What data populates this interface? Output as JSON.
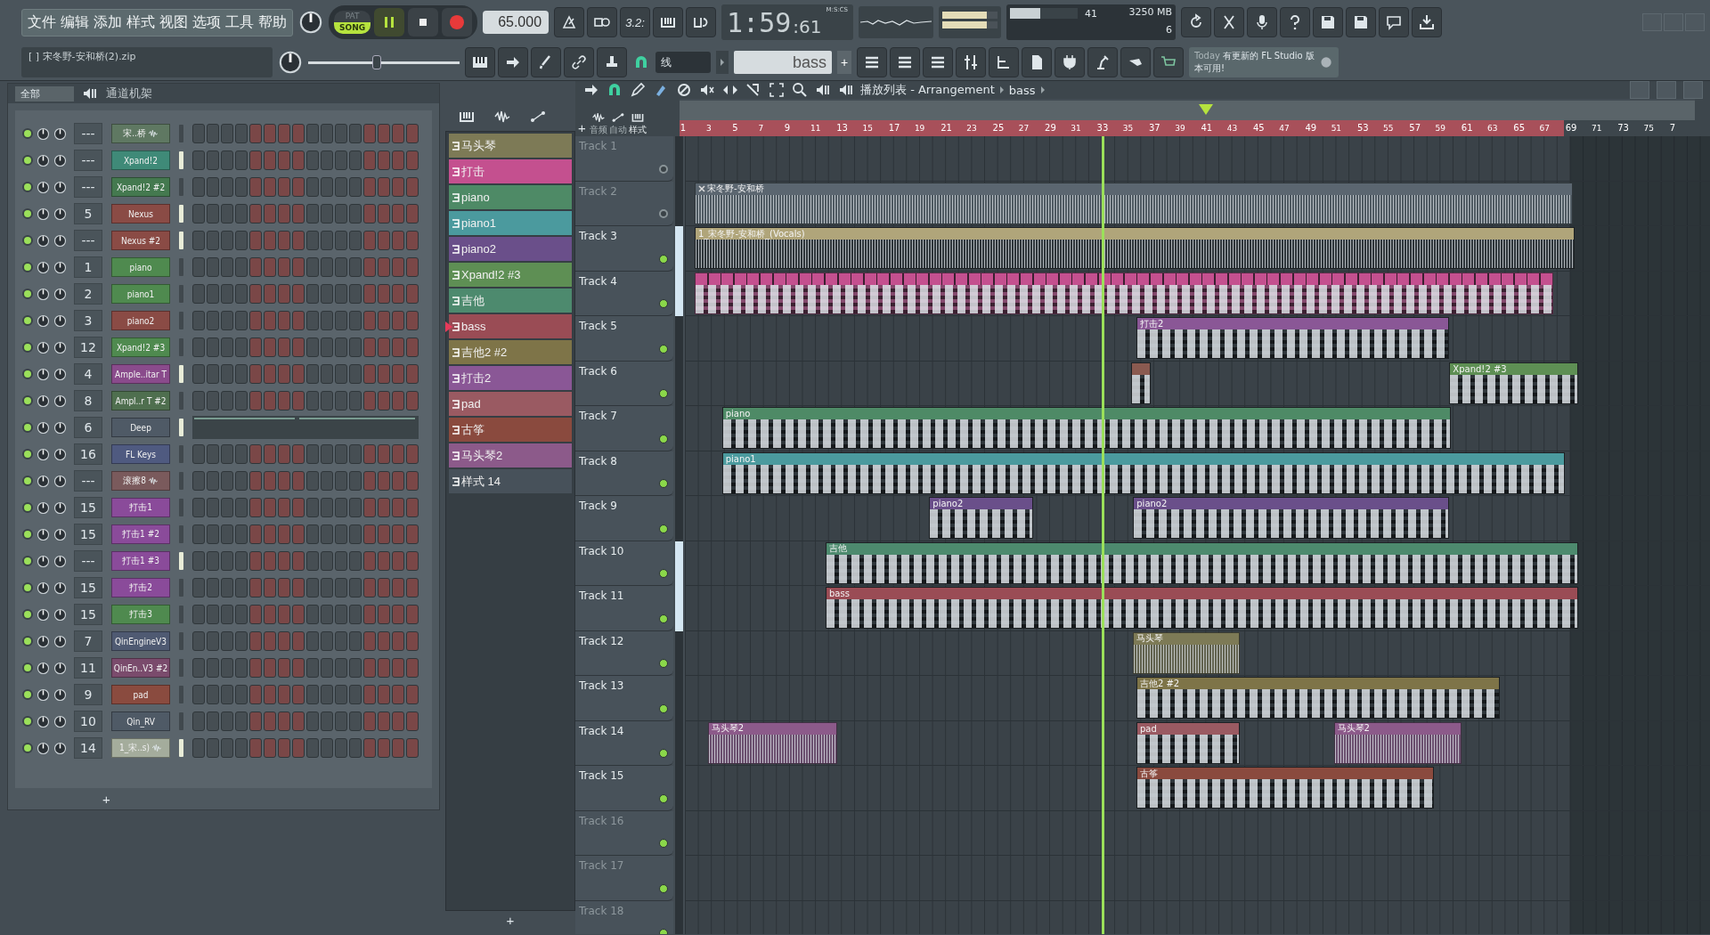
{
  "menu": [
    "文件",
    "编辑",
    "添加",
    "样式",
    "视图",
    "选项",
    "工具",
    "帮助"
  ],
  "transport": {
    "modes": [
      {
        "label": "PAT",
        "selected": false
      },
      {
        "label": "SONG",
        "selected": true
      }
    ],
    "playing": true,
    "tempo": "65.000",
    "countdown": "3.2:",
    "time": "1:59",
    "time_cs": ":61",
    "time_format": "M:S:CS"
  },
  "monitor": {
    "cpu": "41",
    "memory": "3250 MB",
    "polyphony": "6",
    "level": 0.45
  },
  "project_file": "[   ] 宋冬野-安和桥(2).zip",
  "master_slider": {
    "level": 0.45
  },
  "snap": "线",
  "current_pattern": "bass",
  "add_pattern": "+",
  "hint": {
    "day": "Today",
    "message": "有更新的 FL Studio 版本可用!"
  },
  "channel_rack": {
    "filter": "全部",
    "title": "通道机架",
    "add": "+",
    "channels": [
      {
        "number": "---",
        "name": "宋..桥",
        "kind": "sample",
        "color": "#5f7862",
        "selected": false
      },
      {
        "number": "---",
        "name": "Xpand!2",
        "kind": "instrument",
        "color": "#3f8a78",
        "selected": true
      },
      {
        "number": "---",
        "name": "Xpand!2 #2",
        "kind": "instrument",
        "color": "#44794f",
        "selected": false
      },
      {
        "number": "5",
        "name": "Nexus",
        "kind": "instrument",
        "color": "#8a4b45",
        "selected": true
      },
      {
        "number": "---",
        "name": "Nexus #2",
        "kind": "instrument",
        "color": "#8a4b45",
        "selected": true
      },
      {
        "number": "1",
        "name": "piano",
        "kind": "instrument",
        "color": "#4f8a4f",
        "selected": false
      },
      {
        "number": "2",
        "name": "piano1",
        "kind": "instrument",
        "color": "#4f8a4f",
        "selected": false
      },
      {
        "number": "3",
        "name": "piano2",
        "kind": "instrument",
        "color": "#8a4b45",
        "selected": false
      },
      {
        "number": "12",
        "name": "Xpand!2 #3",
        "kind": "instrument",
        "color": "#4f8a4f",
        "selected": false
      },
      {
        "number": "4",
        "name": "Ample..itar T",
        "kind": "instrument",
        "color": "#8a4b8c",
        "selected": true
      },
      {
        "number": "8",
        "name": "Ampl..r T #2",
        "kind": "instrument",
        "color": "#4f6f4f",
        "selected": false
      },
      {
        "number": "6",
        "name": "Deep",
        "kind": "automation",
        "color": "#4f5a66",
        "selected": true
      },
      {
        "number": "16",
        "name": "FL Keys",
        "kind": "instrument",
        "color": "#4f5a80",
        "selected": false
      },
      {
        "number": "---",
        "name": "滚擦8",
        "kind": "sample",
        "color": "#7a5a5c",
        "selected": false
      },
      {
        "number": "15",
        "name": "打击1",
        "kind": "instrument",
        "color": "#8a4b9a",
        "selected": false
      },
      {
        "number": "15",
        "name": "打击1 #2",
        "kind": "instrument",
        "color": "#8a4b9a",
        "selected": false
      },
      {
        "number": "---",
        "name": "打击1 #3",
        "kind": "instrument",
        "color": "#8a4b9a",
        "selected": true
      },
      {
        "number": "15",
        "name": "打击2",
        "kind": "instrument",
        "color": "#8a4b9a",
        "selected": false
      },
      {
        "number": "15",
        "name": "打击3",
        "kind": "instrument",
        "color": "#4f8a4f",
        "selected": false
      },
      {
        "number": "7",
        "name": "QinEngineV3",
        "kind": "instrument",
        "color": "#4f5a72",
        "selected": false
      },
      {
        "number": "11",
        "name": "QinEn..V3 #2",
        "kind": "instrument",
        "color": "#7a4b6c",
        "selected": false
      },
      {
        "number": "9",
        "name": "pad",
        "kind": "instrument",
        "color": "#8a4b3f",
        "selected": false
      },
      {
        "number": "10",
        "name": "Qin_RV",
        "kind": "instrument",
        "color": "#4f5a66",
        "selected": false
      },
      {
        "number": "14",
        "name": "1_宋..s)",
        "kind": "sample",
        "color": "#a4ac9c",
        "selected": true
      }
    ]
  },
  "pattern_list": {
    "add": "+",
    "patterns": [
      {
        "name": "马头琴",
        "color": "#7d7a56",
        "selected": false
      },
      {
        "name": "打击",
        "color": "#c4508f",
        "selected": false
      },
      {
        "name": "piano",
        "color": "#4e8a66",
        "selected": false
      },
      {
        "name": "piano1",
        "color": "#4b9a9e",
        "selected": false
      },
      {
        "name": "piano2",
        "color": "#6a4f8a",
        "selected": false
      },
      {
        "name": "Xpand!2 #3",
        "color": "#5e8f54",
        "selected": false
      },
      {
        "name": "吉他",
        "color": "#4d8a6e",
        "selected": false
      },
      {
        "name": "bass",
        "color": "#9a4c55",
        "selected": true
      },
      {
        "name": "吉他2 #2",
        "color": "#7e7448",
        "selected": false
      },
      {
        "name": "打击2",
        "color": "#8a5796",
        "selected": false
      },
      {
        "name": "pad",
        "color": "#9a5a62",
        "selected": false
      },
      {
        "name": "古筝",
        "color": "#8a4a3e",
        "selected": false
      },
      {
        "name": "马头琴2",
        "color": "#8c5a8a",
        "selected": false
      },
      {
        "name": "样式 14",
        "color": "#47515a",
        "selected": false
      }
    ]
  },
  "playlist": {
    "title": "播放列表 - Arrangement",
    "pattern": "bass",
    "add_track": "+",
    "columns": [
      "音频",
      "自动",
      "样式"
    ],
    "ruler": [
      "1",
      "3",
      "5",
      "7",
      "9",
      "11",
      "13",
      "15",
      "17",
      "19",
      "21",
      "23",
      "25",
      "27",
      "29",
      "31",
      "33",
      "35",
      "37",
      "39",
      "41",
      "43",
      "45",
      "47",
      "49",
      "51",
      "53",
      "55",
      "57",
      "59",
      "61",
      "63",
      "65",
      "67",
      "69",
      "71",
      "73",
      "75",
      "7"
    ],
    "tracks": [
      {
        "name": "Track 1",
        "dimmed": true,
        "active": false,
        "marked": false
      },
      {
        "name": "Track 2",
        "dimmed": true,
        "active": false,
        "marked": false,
        "clips": [
          {
            "kind": "audio",
            "name": "宋冬野-安和桥",
            "color": "#5b6670",
            "muted": true
          }
        ]
      },
      {
        "name": "Track 3",
        "dimmed": false,
        "active": true,
        "marked": true,
        "clips": [
          {
            "kind": "vocal",
            "name": "1_宋冬野-安和桥_(Vocals)",
            "color": "#b0a57a",
            "muted": false
          }
        ]
      },
      {
        "name": "Track 4",
        "dimmed": false,
        "active": true,
        "marked": true,
        "clips": [
          {
            "kind": "strip",
            "color": "#c4508f",
            "muted": false
          }
        ]
      },
      {
        "name": "Track 5",
        "dimmed": false,
        "active": true,
        "marked": false,
        "clips": [
          {
            "kind": "pattern",
            "name": "打击2",
            "color": "#8a5796",
            "muted": false
          }
        ]
      },
      {
        "name": "Track 6",
        "dimmed": false,
        "active": true,
        "marked": false,
        "clips": [
          {
            "kind": "pattern",
            "color": "#8a5a50",
            "muted": false
          },
          {
            "kind": "pattern",
            "name": "Xpand!2 #3",
            "color": "#5e8f54",
            "muted": false
          }
        ]
      },
      {
        "name": "Track 7",
        "dimmed": false,
        "active": true,
        "marked": false,
        "clips": [
          {
            "kind": "pattern",
            "name": "piano",
            "color": "#4e8a66",
            "muted": false
          }
        ]
      },
      {
        "name": "Track 8",
        "dimmed": false,
        "active": true,
        "marked": false,
        "clips": [
          {
            "kind": "pattern",
            "name": "piano1",
            "color": "#4b9a9e",
            "muted": false
          }
        ]
      },
      {
        "name": "Track 9",
        "dimmed": false,
        "active": true,
        "marked": false,
        "clips": [
          {
            "kind": "pattern",
            "name": "piano2",
            "color": "#6a4f8a",
            "muted": false
          },
          {
            "kind": "pattern",
            "name": "piano2",
            "color": "#6a4f8a",
            "muted": false
          }
        ]
      },
      {
        "name": "Track 10",
        "dimmed": false,
        "active": true,
        "marked": true,
        "clips": [
          {
            "kind": "pattern",
            "name": "吉他",
            "color": "#4d8a6e",
            "muted": false
          }
        ]
      },
      {
        "name": "Track 11",
        "dimmed": false,
        "active": true,
        "marked": true,
        "clips": [
          {
            "kind": "pattern",
            "name": "bass",
            "color": "#9a4c55",
            "muted": false
          }
        ]
      },
      {
        "name": "Track 12",
        "dimmed": false,
        "active": true,
        "marked": false,
        "clips": [
          {
            "kind": "audio",
            "name": "马头琴",
            "color": "#7d7a56",
            "muted": false
          }
        ]
      },
      {
        "name": "Track 13",
        "dimmed": false,
        "active": true,
        "marked": false,
        "clips": [
          {
            "kind": "pattern",
            "name": "吉他2 #2",
            "color": "#7e7448",
            "muted": false
          }
        ]
      },
      {
        "name": "Track 14",
        "dimmed": false,
        "active": true,
        "marked": false,
        "clips": [
          {
            "kind": "audio",
            "name": "马头琴2",
            "color": "#8c5a8a",
            "muted": false
          },
          {
            "kind": "pattern",
            "name": "pad",
            "color": "#9a5a62",
            "muted": false
          },
          {
            "kind": "audio",
            "name": "马头琴2",
            "color": "#8c5a8a",
            "muted": false
          }
        ]
      },
      {
        "name": "Track 15",
        "dimmed": false,
        "active": true,
        "marked": false,
        "clips": [
          {
            "kind": "pattern",
            "name": "古筝",
            "color": "#8a4a3e",
            "muted": false
          }
        ]
      },
      {
        "name": "Track 16",
        "dimmed": true,
        "active": true,
        "marked": false
      },
      {
        "name": "Track 17",
        "dimmed": true,
        "active": true,
        "marked": false
      },
      {
        "name": "Track 18",
        "dimmed": true,
        "active": true,
        "marked": false
      }
    ]
  }
}
